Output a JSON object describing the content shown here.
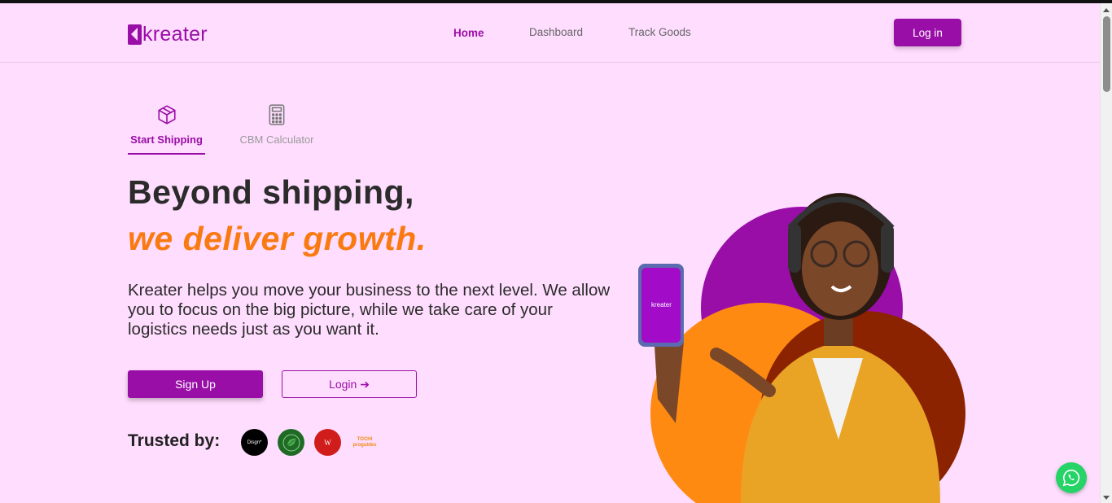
{
  "brand": {
    "name": "kreater",
    "color": "#9A0EA8"
  },
  "nav": {
    "home": "Home",
    "dashboard": "Dashboard",
    "track": "Track Goods",
    "login": "Log in"
  },
  "tabs": [
    {
      "label": "Start Shipping",
      "icon": "box-icon",
      "active": true
    },
    {
      "label": "CBM Calculator",
      "icon": "calculator-icon",
      "active": false
    }
  ],
  "hero": {
    "headline_1": "Beyond shipping,",
    "headline_2": "we deliver growth.",
    "description": "Kreater helps you move your business to the next level. We allow you to focus on the big picture, while we take care of your logistics needs just as you want it.",
    "signup": "Sign Up",
    "login": "Login ➔",
    "phone_brand": "kreater"
  },
  "trusted": {
    "label": "Trusted by:",
    "partners": [
      {
        "name": "Disgn*"
      },
      {
        "name": "leaf-logo"
      },
      {
        "name": "W"
      },
      {
        "name": "proguides",
        "line1": "TOCHI",
        "line2": "proguides"
      }
    ]
  },
  "colors": {
    "accent": "#9A0EA8",
    "orange": "#FA7A12",
    "background": "#FFDDFE",
    "whatsapp": "#25D366"
  }
}
